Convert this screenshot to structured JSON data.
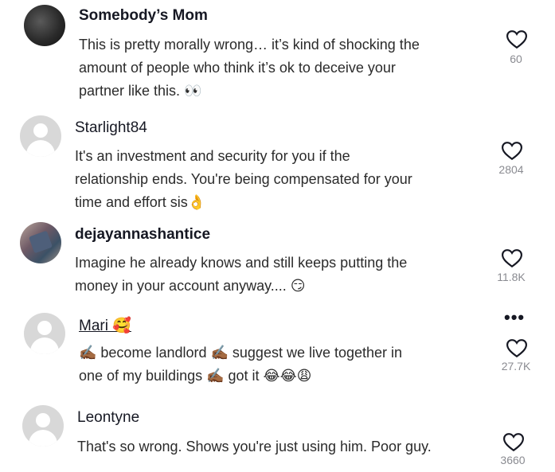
{
  "comments": [
    {
      "username": "Somebody’s Mom",
      "line1": "This is pretty morally wrong… it’s kind of shocking the",
      "line2": "amount of people who think it’s ok to deceive your",
      "line3": "partner like this. 👀",
      "likes": "60",
      "avatar": "dark-photo-avatar"
    },
    {
      "username": "Starlight84",
      "line1": "It's an investment and security for you if the",
      "line2": "relationship ends. You're being compensated for your",
      "line3": "time and effort sis👌",
      "likes": "2804",
      "avatar": "default-avatar"
    },
    {
      "username": "dejayannashantice",
      "line1": "Imagine he already knows and still keeps putting the",
      "line2": "money in your account anyway.... 😏",
      "likes": "11.8K",
      "avatar": "photo-avatar"
    },
    {
      "username": "Mari 🥰",
      "line1": "✍🏾 become landlord ✍🏾 suggest we live together in",
      "line2": "one of my buildings ✍🏾 got it 😂😂😩",
      "likes": "27.7K",
      "avatar": "default-avatar"
    },
    {
      "username": "Leontyne",
      "line1": "That's so wrong. Shows you're just using him. Poor guy.",
      "likes": "3660",
      "avatar": "default-avatar"
    }
  ],
  "more_menu": "•••",
  "colors": {
    "text": "#161823",
    "muted": "#8a8b91",
    "avatar_bg": "#d8d8d8"
  }
}
